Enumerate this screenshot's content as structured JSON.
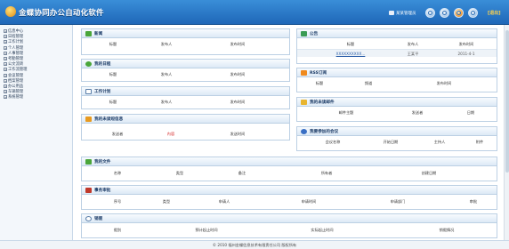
{
  "header": {
    "app_title": "金蝶协同办公自动化软件",
    "user_label": "某某管理员",
    "logout_label": "[退出]",
    "colors": {
      "bar_top": "#3a8ed8",
      "bar_bottom": "#1f67b8"
    }
  },
  "sidebar": {
    "items": [
      {
        "label": "信息中心"
      },
      {
        "label": "日程管理"
      },
      {
        "label": "工作计划"
      },
      {
        "label": "个人管理"
      },
      {
        "label": "人事管理"
      },
      {
        "label": "考勤管理"
      },
      {
        "label": "公文流转"
      },
      {
        "label": "工作流管理"
      },
      {
        "label": "会议管理"
      },
      {
        "label": "档案管理"
      },
      {
        "label": "办公用品"
      },
      {
        "label": "车辆管理"
      },
      {
        "label": "系统管理"
      }
    ]
  },
  "panels": {
    "news": {
      "title": "新闻",
      "headers": [
        "标题",
        "发布人",
        "发布时间"
      ]
    },
    "notice": {
      "title": "公告",
      "headers": [
        "标题",
        "发布人",
        "发布时间"
      ],
      "rows": [
        {
          "title": "XXXXXXXXXX...",
          "publisher": "王某平",
          "time": "2011-4-1"
        }
      ]
    },
    "schedule": {
      "title": "我的日程",
      "headers": [
        "标题",
        "发布人",
        "发布时间"
      ]
    },
    "rss": {
      "title": "RSS订阅",
      "headers": [
        "标题",
        "频道",
        "发布时间"
      ]
    },
    "plan": {
      "title": "工作计划",
      "headers": [
        "标题",
        "发布人",
        "发布时间"
      ]
    },
    "unread_mail": {
      "title": "我的未读邮件",
      "headers": [
        "邮件主题",
        "发送者",
        "日期"
      ]
    },
    "unread_sms": {
      "title": "我的未读短信息",
      "headers": [
        "发送者",
        "内容",
        "发送时间"
      ]
    },
    "meetings": {
      "title": "我要参加的会议",
      "headers": [
        "会议名称",
        "开始日期",
        "主持人",
        "附件"
      ]
    },
    "files": {
      "title": "我的文件",
      "headers": [
        "名称",
        "类型",
        "备注",
        "所有者",
        "创建日期"
      ]
    },
    "approval": {
      "title": "事务审批",
      "headers": [
        "序号",
        "类型",
        "申请人",
        "申请时间",
        "申请部门",
        "审批"
      ]
    },
    "leave": {
      "title": "销假",
      "headers": [
        "假别",
        "预计起止时间",
        "实际起止时间",
        "销假情况"
      ]
    }
  },
  "footer": {
    "text": "© 2010 福州金蝶信息技术有限责任公司 版权所有"
  }
}
